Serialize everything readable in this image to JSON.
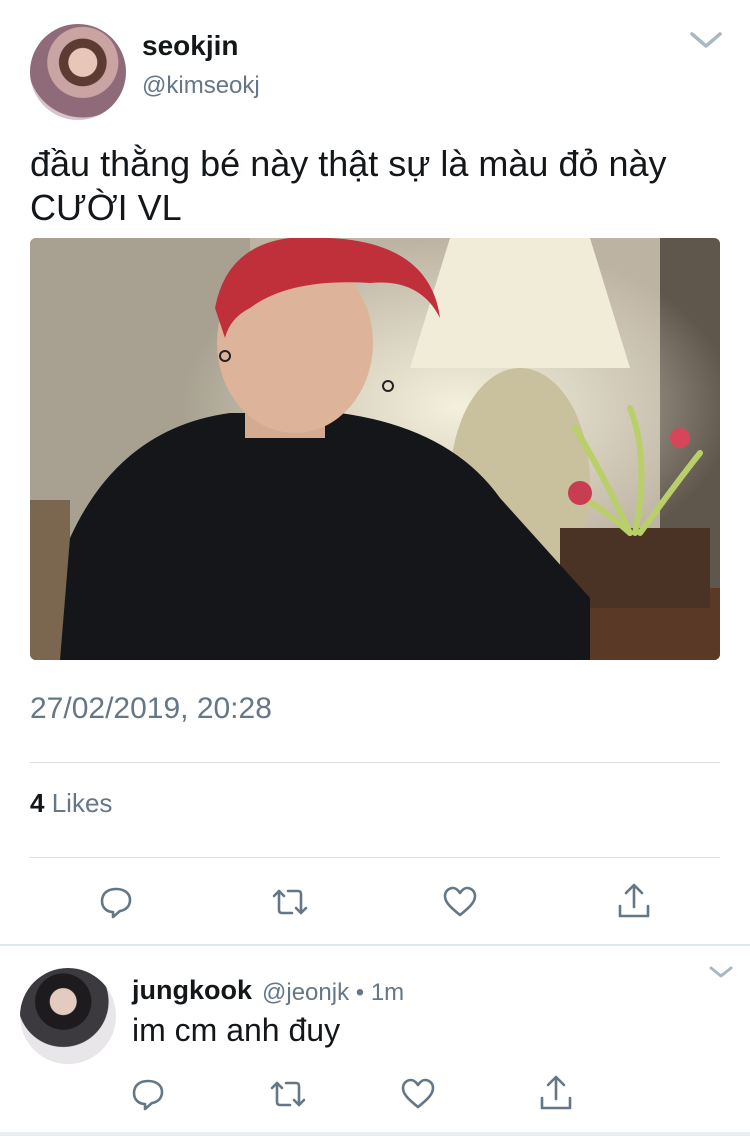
{
  "tweet": {
    "display_name": "seokjin",
    "handle": "@kimseokj",
    "text_line1": "đầu thằng bé này thật sự là màu đỏ này",
    "text_line2": "CƯỜI VL",
    "timestamp": "27/02/2019, 20:28",
    "likes_count": "4",
    "likes_label": "Likes"
  },
  "reply": {
    "display_name": "jungkook",
    "handle": "@jeonjk",
    "separator": "•",
    "time": "1m",
    "text": "im cm anh đuy"
  },
  "colors": {
    "text_primary": "#14171a",
    "text_secondary": "#657786",
    "divider": "#d8dee3",
    "icon": "#657786"
  },
  "icons": [
    "chevron-down-icon",
    "reply-icon",
    "retweet-icon",
    "like-icon",
    "share-icon"
  ]
}
